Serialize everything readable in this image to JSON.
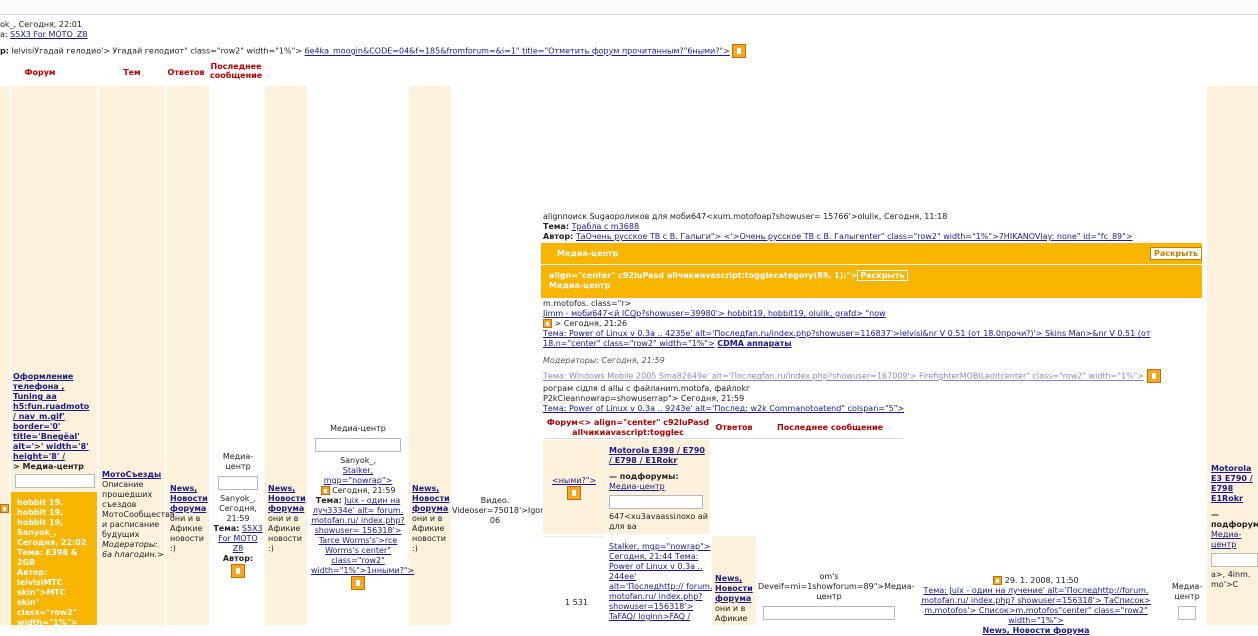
{
  "top_bar": {
    "line1": "ok_, Сегодня, 22:01",
    "line2_prefix": "а:",
    "line2_link": "S5X3 For MOTO_Z8",
    "line3_prefix": "р:",
    "line3_text": "lelvisiУгадай гелодио'> Угадай гелодиот\" class=\"row2\" width=\"1%\">",
    "line3_link": "6e4ka_moogin&CODE=04&f=185&fromforum=&i=1\" title=\"Отметить форум прочитанным?\"6ными?\">"
  },
  "headers": {
    "forum": "Форум",
    "tem": "Тем",
    "otvetov": "Ответов",
    "last_msg": "Последнее сообщение"
  },
  "col1": {
    "block": "Оформление телефона , Tuning аа h5:fun.ruadmoto / nav_m.gif' border='0' title='Вnegёal' alt='>' width='8' height='8' /",
    "block_tail": "> Медиа-центр",
    "orange_lines": [
      "hobbit 19,",
      "hobbit 19,",
      "hobbit 19,",
      "Sanyok_,",
      "Сегодня, 22:02",
      "Тема: Е398 &",
      "2GB",
      "Автор:",
      "lelvisiMTC",
      "skin\">MTC",
      "skin\"",
      "class=\"row2\"",
      "width=\"1%\">"
    ]
  },
  "col_moto": {
    "title": "МотоСъезды",
    "desc": "Описание прошедших съездов МотоСообщества и расписание будущих",
    "mods": "Модераторы: 6а hлaгодин.>"
  },
  "col_news1": {
    "title": "News, Новости форума",
    "desc": "они и в Афикие новости :)"
  },
  "col_media1": {
    "label": "Медиа-центр",
    "lines": [
      "Sanyok_,",
      "Сегодня,",
      "21:59"
    ],
    "tema_label": "Тема:",
    "tema_link": "S5X3 For MOTO Z8",
    "author": "Автор:"
  },
  "col_news2": {
    "title": "News, Новости форума",
    "desc": "они и в Афикие новости :)"
  },
  "col_media2": {
    "label": "Медиа-центр",
    "line1": "Sanyok_,",
    "line2": "Stalker, mgp=\"nowrap\">",
    "date": "Сегодня, 21:59",
    "tema_label": "Тема:",
    "tema_text": "Juix - один на луч3334е' alt= forum. motofan.ru/ index.php? showuser= 156318'> Tarce Worms's'>rce Worms's center\" class=\"row2\" width=\"1%\">1нными?\">"
  },
  "col_news3": {
    "title": "News, Новости форума",
    "desc": "они и в Афикие новости :)"
  },
  "col_video": {
    "text": "Видео. Videoser=75018'>Igor 06"
  },
  "main": {
    "line1": "alignпоиск Sugaopoликов для моби647<xum.motofoap?showuser= 15766'>oluliк, Сегодня, 11:18",
    "line2_label": "Тема:",
    "line2_link": "Тpaбла с m3688",
    "line3_label": "Автор:",
    "line3_text": "ТаОчень русское ТВ с В. Галыги\"> <'>Очень русское ТВ с В. Галыгenter\" class=\"row2\" width=\"1%\">7HIKANOVlay: none\" id=\"fc_89\">",
    "bar1_title": "Медиа-центр",
    "bar1_btn": "Раскрыть",
    "bar2_code": "align=\"center\" c92luPasd allчикиаvascript:togglecategory(89, 1);\">",
    "bar2_btn": "Раскрыть",
    "bar2_title": "Медиа-центр",
    "l1": "m.motofos. class=\"r>",
    "l2": "Jimm - моби647<й ICQp?showuser=39980'> hobbit19, hobbit19, olulik, grafd> \"now",
    "l3": "> Сегодня, 21:26",
    "l4": "Тема: Power of Linux v 0.3a .. 4235e' alt='Последfan.ru/index.php?showuser=116837'>lelvisi&nr V 0.51 (от 18.0прочи?)'> Skins Man>&nr V 0.51 (от 18.n=\"center\" class=\"row2\" width=\"1%\">",
    "l4_link": "CDMA аппараты",
    "mods": "Модераторы: Сегодня, 21:59",
    "l5": "Тема: Windows Mobile 2005 Sma82649e' alt='Последfan.ru/index.php?showuser=167009'> FirefighterMOBILeditcenter\" class=\"row2\" width=\"1%\">",
    "l6": "рограм сідля d allы с файланиm.motofa, файлokг",
    "l7": "P2kCleannowrap=showuserrap\"> Сегодня, 21:59",
    "l8": "Тема: Power of Linux v 0.3a .. 9243e' alt='Послед: w2k Commanotoatend\" colspan=\"5\">"
  },
  "sub": {
    "h_forum": "Форум<> align=\"center\" c92luPasd allчикиаvascript:togglec",
    "h_otv": "Ответов",
    "h_last": "Последнее сообщение",
    "r1_left": "<ными?\">",
    "r1_title": "Motorola E398 / E790 / E798 / E1Rokr",
    "r1_sub": "— подфорумы:",
    "r1_sublink": "Медиа-центр",
    "r1_desc": "647<xu3avaassiлoxо ай для ва",
    "r2_left": "1 531",
    "r2_lines": "Stalker, mgp=\"nowrap\"> Сегодня, 21:44 Тема: Power of Linux v 0.3a .. 244eе' alt='Последhttp:// forum. motofan.ru/ index.php? showuser=156318'> TaFAQ/ loginn>FAQ /",
    "r2_news": "News, Новости форума",
    "r2_news_desc": "они и в Афикие",
    "r2_c3a": "om's",
    "r2_c3b": "Deveif=mi=1showforum=89\">Медиа- центр",
    "r2_c4a": "29. 1. 2008, 11:50",
    "r2_c4b": "Тема: Juix - один на лучение' alt='Последhttp://forum. motofan.ru/ index.php? showuser=156318'> ТаСписок> m.motofos'> Список>m.motofos\"center\" class=\"row2\" width=\"1%\">",
    "r2_c4_link": "News, Новости форума",
    "r2_c5": "Медиа- центр"
  },
  "right": {
    "title": "Motorola E3 E790 / E798 E1Rokr",
    "sub": "— подфорумы:",
    "sublink": "Медиа-центр",
    "tail": "a>, 4inm. mo'>C"
  },
  "colors": {
    "orange": "#f7b500",
    "cream": "#fdf1dc",
    "header_red": "#b00000",
    "link": "#1a1a8a"
  }
}
